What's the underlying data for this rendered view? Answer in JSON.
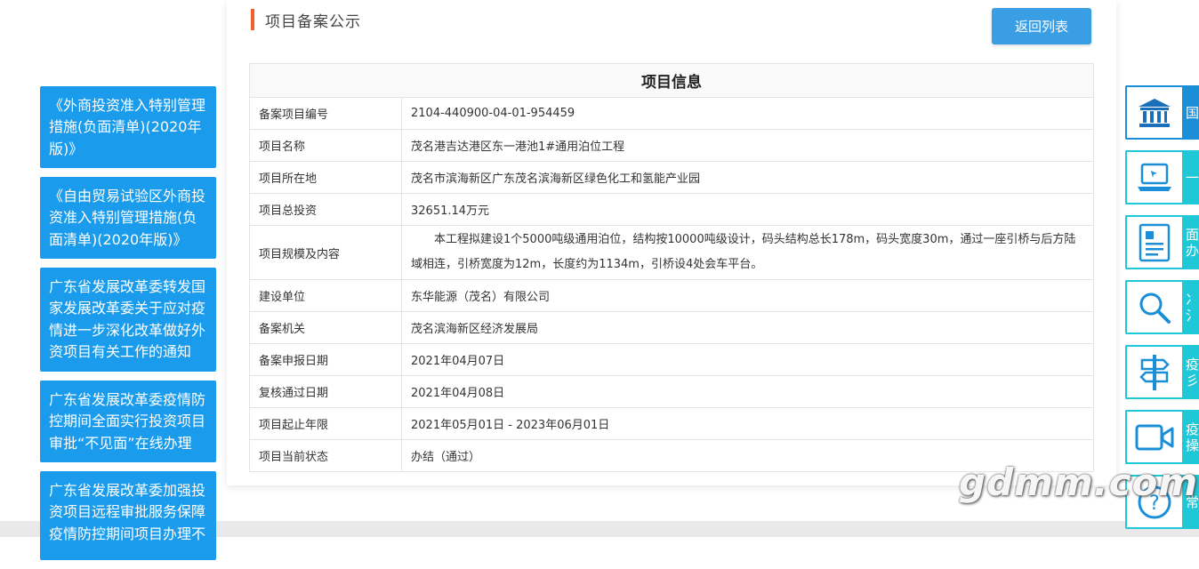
{
  "page": {
    "title": "项目备案公示",
    "back_button": "返回列表",
    "table_title": "项目信息"
  },
  "info_rows": [
    {
      "label": "备案项目编号",
      "value": "2104-440900-04-01-954459"
    },
    {
      "label": "项目名称",
      "value": "茂名港吉达港区东一港池1#通用泊位工程"
    },
    {
      "label": "项目所在地",
      "value": "茂名市滨海新区广东茂名滨海新区绿色化工和氢能产业园"
    },
    {
      "label": "项目总投资",
      "value": "32651.14万元"
    },
    {
      "label": "项目规模及内容",
      "value": "本工程拟建设1个5000吨级通用泊位，结构按10000吨级设计，码头结构总长178m，码头宽度30m，通过一座引桥与后方陆域相连，引桥宽度为12m，长度约为1134m，引桥设4处会车平台。"
    },
    {
      "label": "建设单位",
      "value": "东华能源（茂名）有限公司"
    },
    {
      "label": "备案机关",
      "value": "茂名滨海新区经济发展局"
    },
    {
      "label": "备案申报日期",
      "value": "2021年04月07日"
    },
    {
      "label": "复核通过日期",
      "value": "2021年04月08日"
    },
    {
      "label": "项目起止年限",
      "value": "2021年05月01日 - 2023年06月01日"
    },
    {
      "label": "项目当前状态",
      "value": "办结（通过）"
    }
  ],
  "notices": [
    "《外商投资准入特别管理措施(负面清单)(2020年版)》",
    "《自由贸易试验区外商投资准入特别管理措施(负面清单)(2020年版)》",
    "广东省发展改革委转发国家发展改革委关于应对疫情进一步深化改革做好外资项目有关工作的通知",
    "广东省发展改革委疫情防控期间全面实行投资项目审批“不见面”在线办理",
    "广东省发展改革委加强投资项目远程审批服务保障疫情防控期间项目办理不"
  ],
  "rail": [
    {
      "icon": "bank-icon",
      "label1": "国",
      "label2": ""
    },
    {
      "icon": "laptop-icon",
      "label1": "一",
      "label2": ""
    },
    {
      "icon": "document-icon",
      "label1": "面",
      "label2": "办"
    },
    {
      "icon": "search-icon",
      "label1": "冫",
      "label2": "氵"
    },
    {
      "icon": "signpost-icon",
      "label1": "疫",
      "label2": "彡"
    },
    {
      "icon": "video-icon",
      "label1": "疫",
      "label2": "操"
    },
    {
      "icon": "help-icon",
      "label1": "常",
      "label2": ""
    }
  ],
  "watermark": "gdmm.com",
  "colors": {
    "accent_orange": "#f0622b",
    "button_blue": "#3a9ee4",
    "notice_blue": "#1a9bec",
    "rail_cyan": "#1ec8d6",
    "rail_active_blue": "#1a8fd8"
  }
}
